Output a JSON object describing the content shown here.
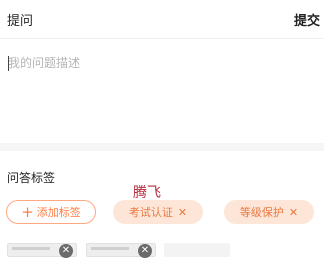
{
  "header": {
    "title": "提问",
    "submit_label": "提交"
  },
  "question": {
    "placeholder": "我的问题描述",
    "value": ""
  },
  "tags_section": {
    "label": "问答标签",
    "add_label": "添加标签",
    "tags": [
      {
        "label": "考试认证"
      },
      {
        "label": "等级保护"
      }
    ],
    "remove_icon": "close-icon"
  },
  "overlay": {
    "text": "腾飞"
  },
  "images": {
    "remove_icon": "close-icon"
  }
}
